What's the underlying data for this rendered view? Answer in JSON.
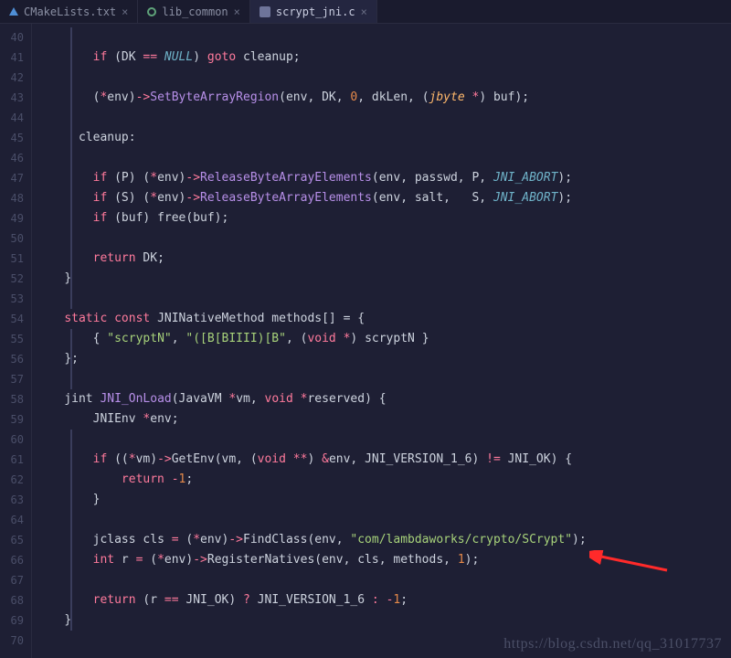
{
  "tabs": [
    {
      "label": "CMakeLists.txt"
    },
    {
      "label": "lib_common"
    },
    {
      "label": "scrypt_jni.c"
    }
  ],
  "gutter": [
    "40",
    "41",
    "42",
    "43",
    "44",
    "45",
    "46",
    "47",
    "48",
    "49",
    "50",
    "51",
    "52",
    "53",
    "54",
    "55",
    "56",
    "57",
    "58",
    "59",
    "60",
    "61",
    "62",
    "63",
    "64",
    "65",
    "66",
    "67",
    "68",
    "69",
    "70"
  ],
  "code": {
    "l40": {},
    "l41": {
      "kw": "if",
      "a": " (DK ",
      "op": "==",
      "sp": " ",
      "null": "NULL",
      "b": ") ",
      "goto": "goto",
      "c": " cleanup;"
    },
    "l42": {},
    "l43": {
      "a": "(",
      "op1": "*",
      "b": "env)",
      "arrow": "->",
      "fn": "SetByteArrayRegion",
      "c": "(env, DK, ",
      "n": "0",
      "d": ", dkLen, (",
      "t": "jbyte ",
      "op2": "*",
      "e": ") buf);"
    },
    "l44": {},
    "l45": {
      "a": "cleanup:"
    },
    "l46": {},
    "l47": {
      "kw": "if",
      "a": " (P) (",
      "op": "*",
      "b": "env)",
      "arrow": "->",
      "fn": "ReleaseByteArrayElements",
      "c": "(env, passwd, P, ",
      "abort": "JNI_ABORT",
      "d": ");"
    },
    "l48": {
      "kw": "if",
      "a": " (S) (",
      "op": "*",
      "b": "env)",
      "arrow": "->",
      "fn": "ReleaseByteArrayElements",
      "c": "(env, salt,   S, ",
      "abort": "JNI_ABORT",
      "d": ");"
    },
    "l49": {
      "kw": "if",
      "a": " (buf) free(buf);"
    },
    "l50": {},
    "l51": {
      "kw": "return",
      "a": " DK;"
    },
    "l52": {
      "a": "}"
    },
    "l53": {},
    "l54": {
      "kw1": "static",
      "sp1": " ",
      "kw2": "const",
      "sp2": " ",
      "a": "JNINativeMethod methods[] = {"
    },
    "l55": {
      "a": "{ ",
      "s1": "\"scryptN\"",
      "b": ", ",
      "s2": "\"([B[BIIII)[B\"",
      "c": ", (",
      "kw": "void",
      "sp": " ",
      "op": "*",
      "d": ") scryptN }"
    },
    "l56": {
      "a": "};"
    },
    "l57": {},
    "l58": {
      "a": "jint ",
      "fn": "JNI_OnLoad",
      "b": "(JavaVM ",
      "op1": "*",
      "c": "vm, ",
      "kw": "void",
      "sp": " ",
      "op2": "*",
      "d": "reserved) {"
    },
    "l59": {
      "a": "JNIEnv ",
      "op": "*",
      "b": "env;"
    },
    "l60": {},
    "l61": {
      "kw": "if",
      "a": " ((",
      "op1": "*",
      "b": "vm)",
      "arrow": "->",
      "c": "GetEnv(vm, (",
      "kw2": "void",
      "sp": " ",
      "op2": "**",
      "d": ") ",
      "op3": "&",
      "e": "env, JNI_VERSION_1_6) ",
      "op4": "!=",
      "f": " JNI_OK) {"
    },
    "l62": {
      "kw": "return",
      "sp": " ",
      "op": "-",
      "n": "1",
      "a": ";"
    },
    "l63": {
      "a": "}"
    },
    "l64": {},
    "l65": {
      "a": "jclass cls ",
      "op1": "=",
      "b": " (",
      "op2": "*",
      "c": "env)",
      "arrow": "->",
      "d": "FindClass(env, ",
      "s": "\"com/lambdaworks/crypto/SCrypt\"",
      "e": ");"
    },
    "l66": {
      "kw": "int",
      "a": " r ",
      "op1": "=",
      "b": " (",
      "op2": "*",
      "c": "env)",
      "arrow": "->",
      "d": "RegisterNatives(env, cls, methods, ",
      "n": "1",
      "e": ");"
    },
    "l67": {},
    "l68": {
      "kw": "return",
      "a": " (r ",
      "op1": "==",
      "b": " JNI_OK) ",
      "op2": "?",
      "c": " JNI_VERSION_1_6 ",
      "op3": ":",
      "sp": " ",
      "op4": "-",
      "n": "1",
      "d": ";"
    },
    "l69": {
      "a": "}"
    },
    "l70": {}
  },
  "watermark": "https://blog.csdn.net/qq_31017737"
}
